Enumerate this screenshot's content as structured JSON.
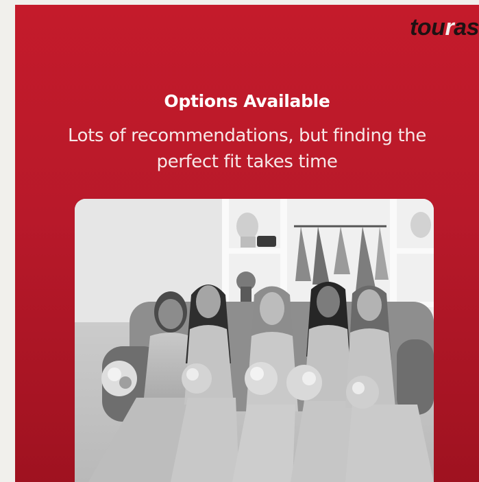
{
  "logo": {
    "before": "tou",
    "accent": "r",
    "after": "as"
  },
  "headline": "Options Available",
  "subline": "Lots of recommendations, but finding the perfect fit takes time",
  "photo": {
    "subject": "five bridesmaids seated on a sofa holding bouquets",
    "style": "black-and-white"
  },
  "colors": {
    "page_background": "#f1f0ec",
    "card_red": "#c41b2b",
    "headline_text": "#ffffff",
    "logo_dark": "#1d1213"
  }
}
